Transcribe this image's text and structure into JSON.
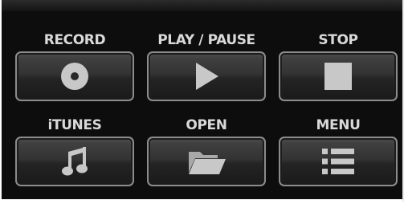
{
  "controls": {
    "record": {
      "label": "RECORD",
      "icon": "disc-icon"
    },
    "play_pause": {
      "label": "PLAY / PAUSE",
      "icon": "play-icon"
    },
    "stop": {
      "label": "STOP",
      "icon": "stop-icon"
    },
    "itunes": {
      "label": "iTUNES",
      "icon": "music-note-icon"
    },
    "open": {
      "label": "OPEN",
      "icon": "folder-icon"
    },
    "menu": {
      "label": "MENU",
      "icon": "list-icon"
    }
  },
  "colors": {
    "panel_background": "#0d0d0d",
    "label_text": "#d9d9d9",
    "icon": "#c8c8c8",
    "button_border": "#8c8c8c"
  }
}
